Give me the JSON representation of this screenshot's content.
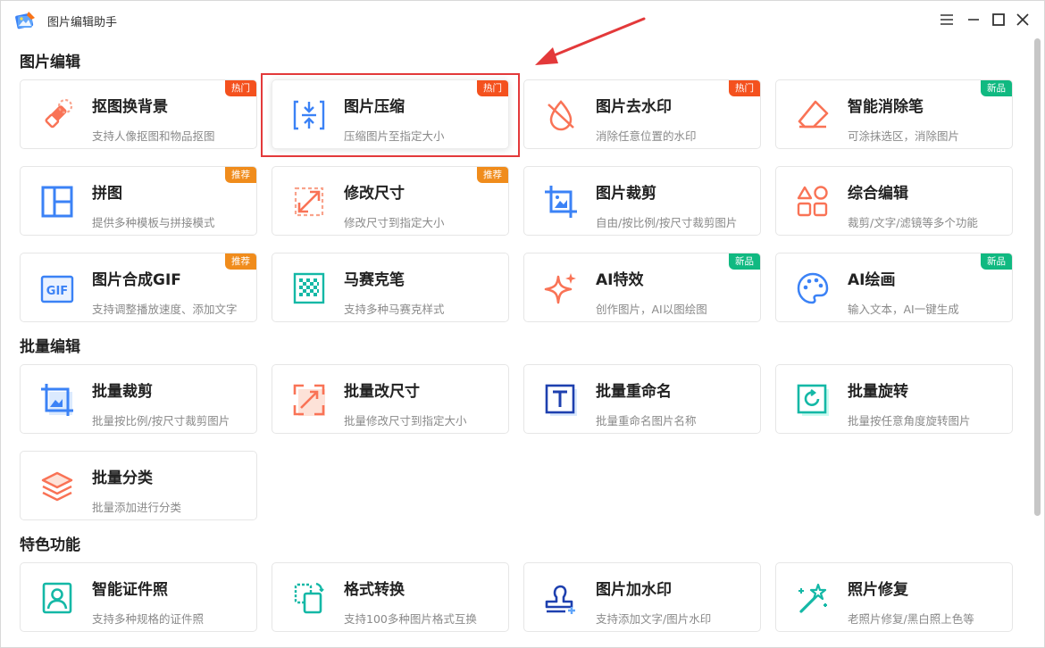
{
  "app": {
    "title": "图片编辑助手"
  },
  "colors": {
    "hot": "#f4511e",
    "new": "#10b981",
    "recommend": "#f08c1c",
    "highlight_box": "#e3393a"
  },
  "sections": [
    {
      "title": "图片编辑",
      "cards": [
        {
          "name": "抠图换背景",
          "desc": "支持人像抠图和物品抠图",
          "badge": "热门",
          "icon": "eraser-icon"
        },
        {
          "name": "图片压缩",
          "desc": "压缩图片至指定大小",
          "badge": "热门",
          "icon": "compress-icon"
        },
        {
          "name": "图片去水印",
          "desc": "消除任意位置的水印",
          "badge": "热门",
          "icon": "no-watermark-icon"
        },
        {
          "name": "智能消除笔",
          "desc": "可涂抹选区，消除图片",
          "badge": "新品",
          "icon": "smart-eraser-icon"
        },
        {
          "name": "拼图",
          "desc": "提供多种模板与拼接模式",
          "badge": "推荐",
          "icon": "collage-icon"
        },
        {
          "name": "修改尺寸",
          "desc": "修改尺寸到指定大小",
          "badge": "推荐",
          "icon": "resize-icon"
        },
        {
          "name": "图片裁剪",
          "desc": "自由/按比例/按尺寸裁剪图片",
          "badge": "",
          "icon": "crop-icon"
        },
        {
          "name": "综合编辑",
          "desc": "裁剪/文字/滤镜等多个功能",
          "badge": "",
          "icon": "shapes-icon"
        },
        {
          "name": "图片合成GIF",
          "desc": "支持调整播放速度、添加文字",
          "badge": "推荐",
          "icon": "gif-icon"
        },
        {
          "name": "马赛克笔",
          "desc": "支持多种马赛克样式",
          "badge": "",
          "icon": "mosaic-icon"
        },
        {
          "name": "AI特效",
          "desc": "创作图片，AI以图绘图",
          "badge": "新品",
          "icon": "sparkle-icon"
        },
        {
          "name": "AI绘画",
          "desc": "输入文本，AI一键生成",
          "badge": "新品",
          "icon": "palette-icon"
        }
      ]
    },
    {
      "title": "批量编辑",
      "cards": [
        {
          "name": "批量裁剪",
          "desc": "批量按比例/按尺寸裁剪图片",
          "badge": "",
          "icon": "batch-crop-icon"
        },
        {
          "name": "批量改尺寸",
          "desc": "批量修改尺寸到指定大小",
          "badge": "",
          "icon": "batch-resize-icon"
        },
        {
          "name": "批量重命名",
          "desc": "批量重命名图片名称",
          "badge": "",
          "icon": "rename-icon"
        },
        {
          "name": "批量旋转",
          "desc": "批量按任意角度旋转图片",
          "badge": "",
          "icon": "rotate-icon"
        },
        {
          "name": "批量分类",
          "desc": "批量添加进行分类",
          "badge": "",
          "icon": "layers-icon"
        }
      ]
    },
    {
      "title": "特色功能",
      "cards": [
        {
          "name": "智能证件照",
          "desc": "支持多种规格的证件照",
          "badge": "",
          "icon": "id-photo-icon"
        },
        {
          "name": "格式转换",
          "desc": "支持100多种图片格式互换",
          "badge": "",
          "icon": "convert-icon"
        },
        {
          "name": "图片加水印",
          "desc": "支持添加文字/图片水印",
          "badge": "",
          "icon": "stamp-icon"
        },
        {
          "name": "照片修复",
          "desc": "老照片修复/黑白照上色等",
          "badge": "",
          "icon": "magic-wand-icon"
        }
      ]
    }
  ]
}
